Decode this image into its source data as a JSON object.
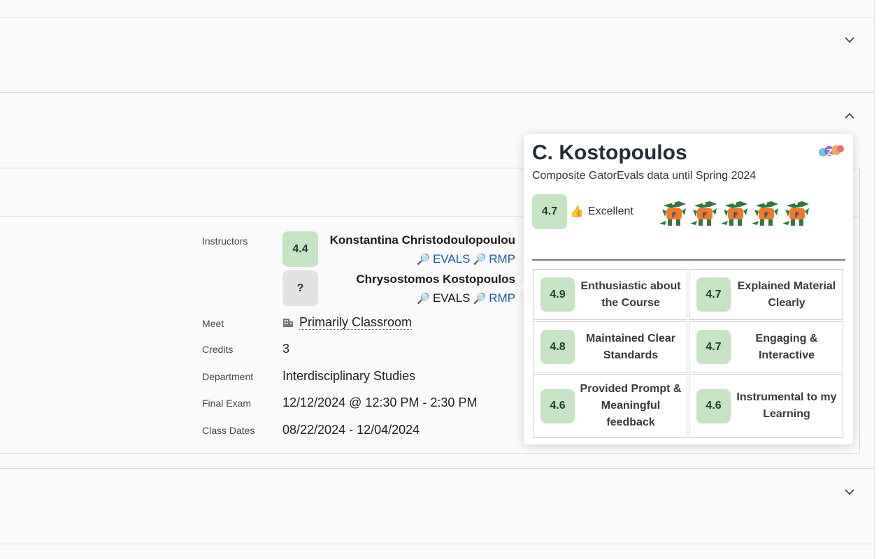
{
  "instructors": {
    "label": "Instructors",
    "list": [
      {
        "score": "4.4",
        "name": "Konstantina Christodoulopoulou",
        "evals": "EVALS",
        "rmp": "RMP"
      },
      {
        "score": "?",
        "name": "Chrysostomos Kostopoulos",
        "evals": "EVALS",
        "rmp": "RMP"
      }
    ]
  },
  "meet": {
    "label": "Meet",
    "value": "Primarily Classroom"
  },
  "credits": {
    "label": "Credits",
    "value": "3"
  },
  "department": {
    "label": "Department",
    "value": "Interdisciplinary Studies"
  },
  "final_exam": {
    "label": "Final Exam",
    "value": "12/12/2024 @ 12:30 PM - 2:30 PM"
  },
  "class_dates": {
    "label": "Class Dates",
    "value": "08/22/2024 - 12/04/2024"
  },
  "popup": {
    "title": "C. Kostopoulos",
    "subtitle": "Composite GatorEvals data until Spring 2024",
    "overall_score": "4.7",
    "rating_emoji": "👍",
    "rating_label": "Excellent",
    "gator_rating": 5,
    "metrics": [
      {
        "score": "4.9",
        "label": "Enthusiastic about the Course"
      },
      {
        "score": "4.7",
        "label": "Explained Material Clearly"
      },
      {
        "score": "4.8",
        "label": "Maintained Clear Standards"
      },
      {
        "score": "4.7",
        "label": "Engaging & Interactive"
      },
      {
        "score": "4.6",
        "label": "Provided Prompt & Meaningful feedback"
      },
      {
        "score": "4.6",
        "label": "Instrumental to my Learning"
      }
    ]
  },
  "colors": {
    "score_green": "#c6e4c4",
    "score_grey": "#e2e2e2",
    "link_blue": "#1b5aa5"
  },
  "icons": [
    "chevron-down-icon",
    "chevron-up-icon",
    "magnifier-icon",
    "building-icon",
    "gator-icon",
    "app-logo-icon",
    "thumbs-up-icon"
  ]
}
